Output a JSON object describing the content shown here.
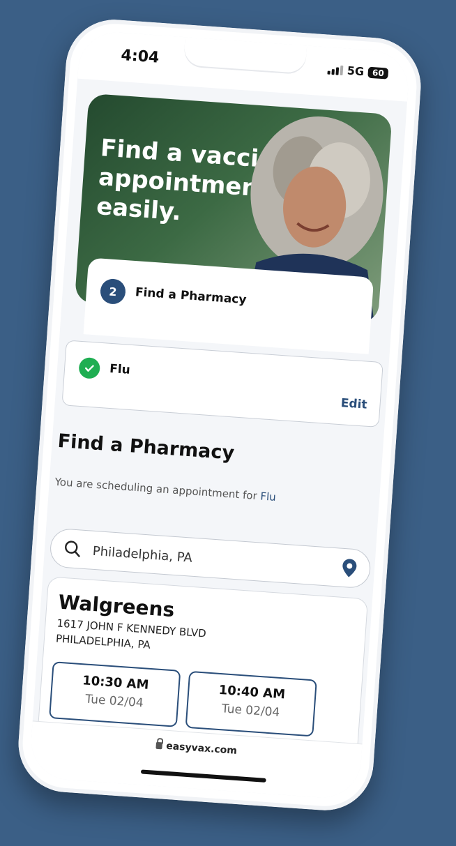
{
  "status": {
    "time": "4:04",
    "network": "5G",
    "battery": "60"
  },
  "hero": {
    "title": "Find a vaccine appointment easily."
  },
  "step": {
    "number": "2",
    "label": "Find a Pharmacy"
  },
  "selected_vaccine": {
    "name": "Flu",
    "edit_label": "Edit"
  },
  "section": {
    "title": "Find a Pharmacy",
    "subtitle_prefix": "You are scheduling an appointment for",
    "subtitle_vaccine": "Flu"
  },
  "search": {
    "value": "Philadelphia, PA"
  },
  "pharmacy": {
    "name": "Walgreens",
    "address_line1": "1617 JOHN F KENNEDY BLVD",
    "address_line2": "PHILADELPHIA, PA",
    "slots": [
      {
        "time": "10:30 AM",
        "date": "Tue 02/04"
      },
      {
        "time": "10:40 AM",
        "date": "Tue 02/04"
      }
    ]
  },
  "browser": {
    "url": "easyvax.com"
  },
  "colors": {
    "background": "#3b5f86",
    "accent": "#2a4e7a",
    "success": "#1fae52"
  }
}
